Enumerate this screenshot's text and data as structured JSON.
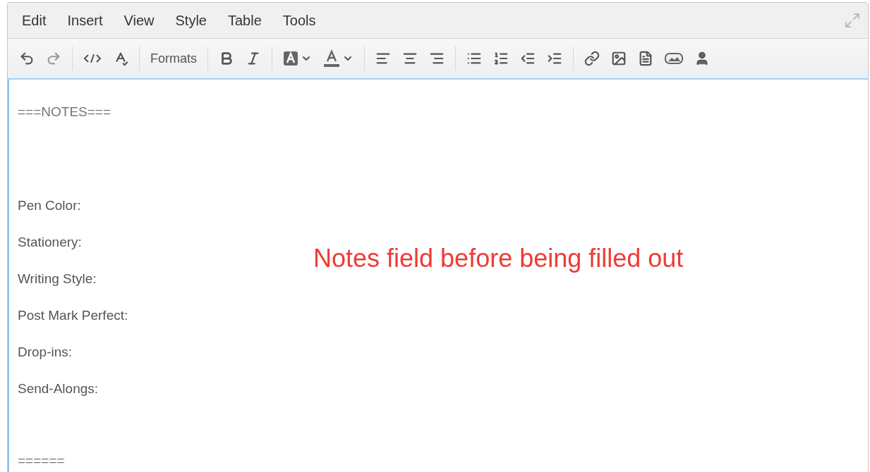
{
  "menu": [
    {
      "label": "Edit"
    },
    {
      "label": "Insert"
    },
    {
      "label": "View"
    },
    {
      "label": "Style"
    },
    {
      "label": "Table"
    },
    {
      "label": "Tools"
    }
  ],
  "toolbar": {
    "formats_label": "Formats"
  },
  "content": {
    "header": "===NOTES===",
    "fields": [
      {
        "label": "Pen Color:"
      },
      {
        "label": "Stationery:"
      },
      {
        "label": "Writing Style:"
      },
      {
        "label": "Post Mark Perfect:"
      },
      {
        "label": "Drop-ins:"
      },
      {
        "label": "Send-Alongs:"
      }
    ],
    "footer": "======"
  },
  "annotation": "Notes field before being filled out"
}
